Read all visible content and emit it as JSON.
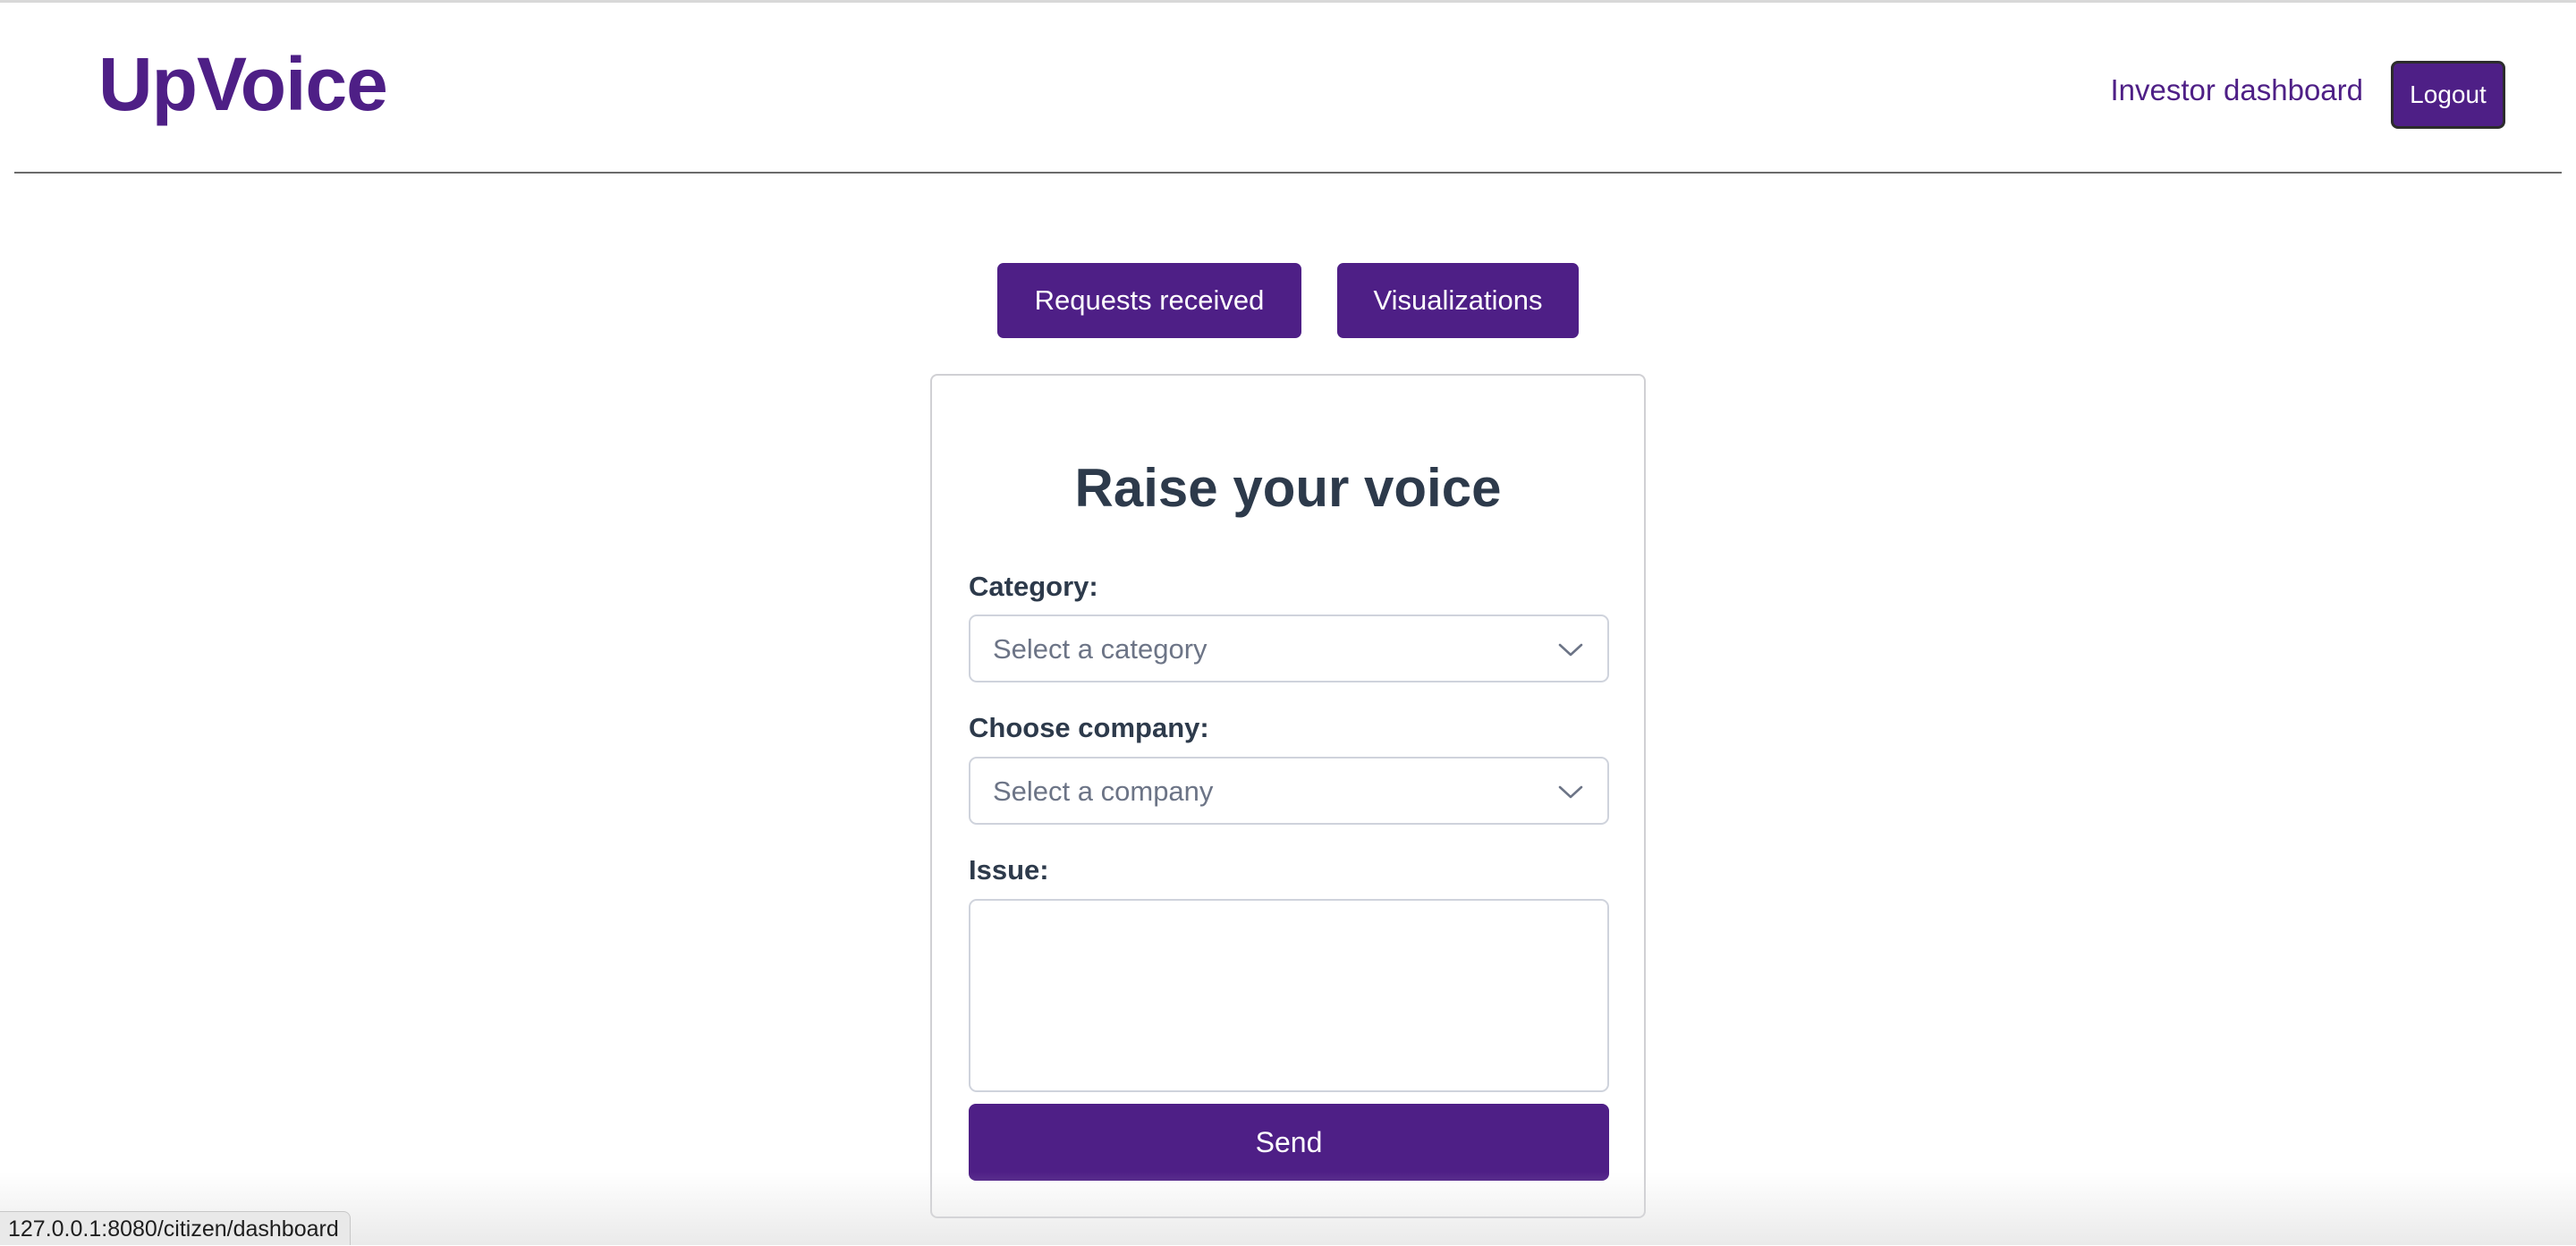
{
  "header": {
    "logo": "UpVoice",
    "nav_link": "Investor dashboard",
    "logout_label": "Logout"
  },
  "tabs": [
    {
      "label": "Requests received"
    },
    {
      "label": "Visualizations"
    }
  ],
  "form": {
    "title": "Raise your voice",
    "category": {
      "label": "Category:",
      "placeholder": "Select a category"
    },
    "company": {
      "label": "Choose company:",
      "placeholder": "Select a company"
    },
    "issue": {
      "label": "Issue:",
      "value": ""
    },
    "send_label": "Send"
  },
  "status_bar": {
    "url": "127.0.0.1:8080/citizen/dashboard"
  },
  "colors": {
    "brand": "#4e1f86",
    "heading_text": "#2d3a4b",
    "placeholder_text": "#6c7486"
  },
  "icons": {
    "select_arrow": "chevron-down-icon"
  }
}
